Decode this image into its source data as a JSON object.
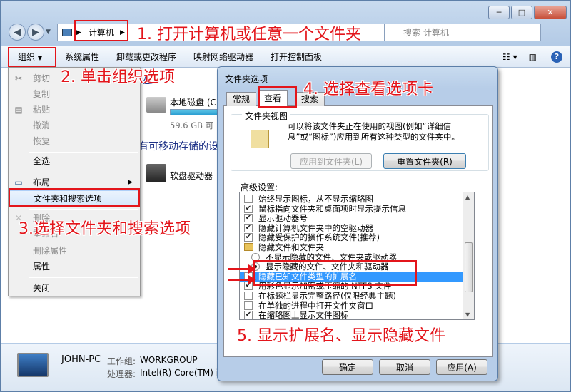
{
  "window": {
    "caption_min": "─",
    "caption_max": "□",
    "caption_close": "✕"
  },
  "address": {
    "crumb": "计算机",
    "search_placeholder": "搜索 计算机"
  },
  "toolbar": {
    "organize": "组织",
    "items": [
      "系统属性",
      "卸载或更改程序",
      "映射网络驱动器",
      "打开控制面板"
    ]
  },
  "content": {
    "local_disk": "本地磁盘 (C",
    "disk_free": "59.6 GB 可",
    "removable_header": "有可移动存储的设",
    "floppy": "软盘驱动器"
  },
  "menu": {
    "items": [
      "剪切",
      "复制",
      "粘贴",
      "撤消",
      "恢复",
      "全选",
      "布局",
      "文件夹和搜索选项",
      "删除",
      "重命名",
      "删除属性",
      "属性",
      "关闭"
    ]
  },
  "statusbar": {
    "computer_name": "JOHN-PC",
    "workgroup_label": "工作组:",
    "workgroup": "WORKGROUP",
    "cpu_label": "处理器:",
    "cpu": "Intel(R) Core(TM) i"
  },
  "dialog": {
    "title": "文件夹选项",
    "tabs": [
      "常规",
      "查看",
      "搜索"
    ],
    "folder_views_label": "文件夹视图",
    "folder_views_desc": "可以将该文件夹正在使用的视图(例如“详细信息”或“图标”)应用到所有这种类型的文件夹中。",
    "apply_to_folders": "应用到文件夹(L)",
    "reset_folders": "重置文件夹(R)",
    "advanced_label": "高级设置:",
    "settings": [
      {
        "text": "始终显示图标，从不显示缩略图",
        "kind": "check",
        "checked": false
      },
      {
        "text": "鼠标指向文件夹和桌面项时显示提示信息",
        "kind": "check",
        "checked": true
      },
      {
        "text": "显示驱动器号",
        "kind": "check",
        "checked": true
      },
      {
        "text": "隐藏计算机文件夹中的空驱动器",
        "kind": "check",
        "checked": true
      },
      {
        "text": "隐藏受保护的操作系统文件(推荐)",
        "kind": "check",
        "checked": true
      },
      {
        "text": "隐藏文件和文件夹",
        "kind": "folder",
        "checked": false
      },
      {
        "text": "不显示隐藏的文件、文件夹或驱动器",
        "kind": "radio",
        "checked": false
      },
      {
        "text": "显示隐藏的文件、文件夹和驱动器",
        "kind": "radio",
        "checked": true
      },
      {
        "text": "隐藏已知文件类型的扩展名",
        "kind": "check",
        "checked": false
      },
      {
        "text": "用彩色显示加密或压缩的 NTFS 文件",
        "kind": "check",
        "checked": true
      },
      {
        "text": "在标题栏显示完整路径(仅限经典主题)",
        "kind": "check",
        "checked": false
      },
      {
        "text": "在单独的进程中打开文件夹窗口",
        "kind": "check",
        "checked": false
      },
      {
        "text": "在缩略图上显示文件图标",
        "kind": "check",
        "checked": true
      }
    ],
    "ok": "确定",
    "cancel": "取消",
    "apply": "应用(A)"
  },
  "annotations": {
    "step1": "1. 打开计算机或任意一个文件夹",
    "step2": "2. 单击组织选项",
    "step3": "3.选择文件夹和搜索选项",
    "step4": "4. 选择查看选项卡",
    "step5": "5. 显示扩展名、显示隐藏文件"
  },
  "colors": {
    "annotation_red": "#e3151b",
    "selection_blue": "#3399ff"
  }
}
